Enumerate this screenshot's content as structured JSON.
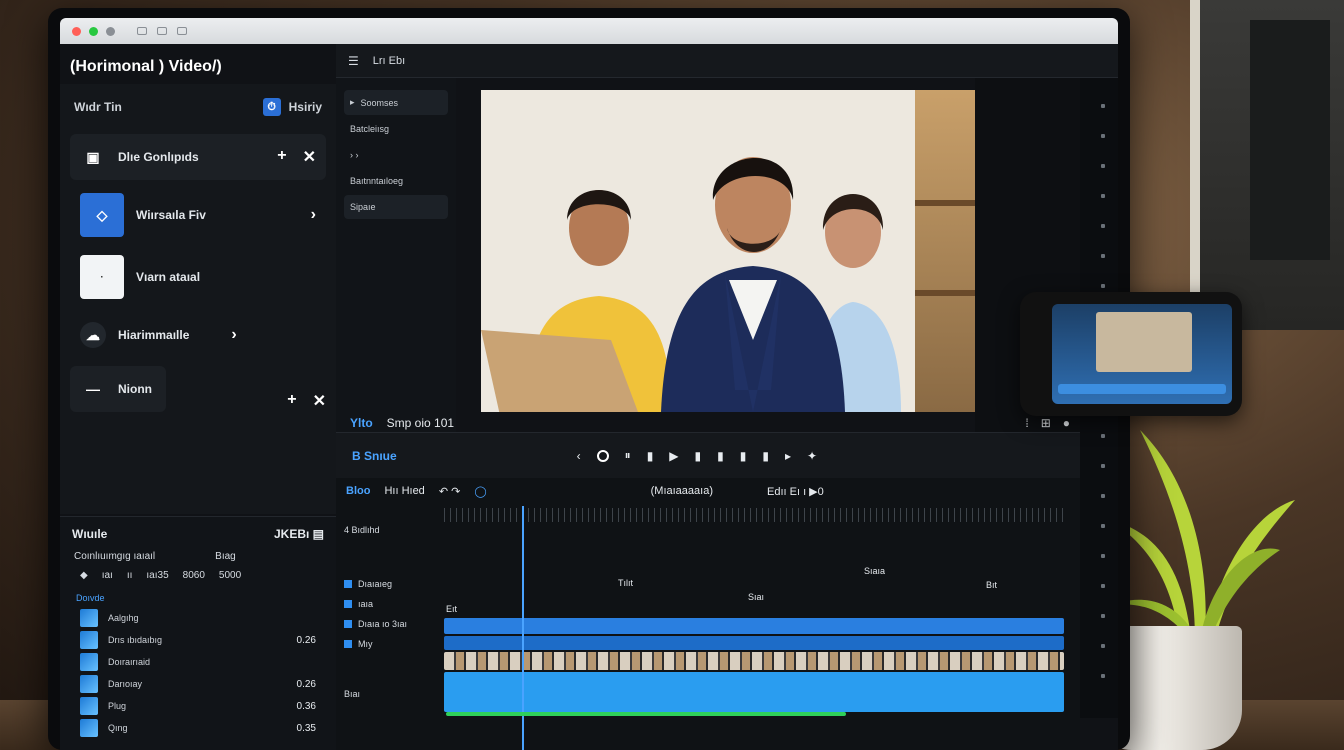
{
  "window": {
    "app_title": "(Horimonal ) Video/)",
    "top_strip": [
      "☰",
      "Lrı Ebı"
    ],
    "titlebar_colors": [
      "#ff5f57",
      "#28c840",
      "#8a8f95"
    ]
  },
  "left_panel": {
    "header": "Wıdr Tin",
    "history_label": "Hsiriy",
    "history_icon": "history-icon",
    "items": [
      {
        "label": "Dlıe Gonlıpıds",
        "icon": "film-icon",
        "actions": [
          "+",
          "✕"
        ]
      },
      {
        "label": "Wiırsaıla   Fiv",
        "icon": "diamond-icon",
        "actions": [
          "›"
        ],
        "accent": "#2b6fd6"
      },
      {
        "label": "Vıarn ataıal",
        "icon": "checkbox-icon",
        "actions": []
      },
      {
        "label": "Hiarimmaılle",
        "icon": "cloud-icon",
        "actions": [
          "›"
        ]
      },
      {
        "label": "Nionn",
        "icon": "minus-icon",
        "actions": [
          "+",
          "✕"
        ]
      }
    ]
  },
  "effects_panel": {
    "items": [
      "Soomses",
      "Batcleiısg",
      "›   ›",
      "Baıtnntaıloeg",
      "Sipaıe"
    ]
  },
  "preview": {
    "status_left": "Ylto",
    "status_text": "Smp oio 101",
    "status_right": [
      "⁞",
      "⊞",
      "●"
    ]
  },
  "controls": {
    "label": "B Snıue",
    "icons": [
      "‹",
      "○",
      "⏸",
      "▮",
      "▶",
      "▮",
      "▮",
      "▮",
      "▮",
      "▸",
      "✦"
    ]
  },
  "media_panel": {
    "header": "Wıuıle",
    "header_right": "JKEBı  ▤",
    "sub_left": "Coınlıuımgıg ıaıaıl",
    "sub_right": "Bıag",
    "tools": [
      "◆",
      "ıaı",
      "ıı",
      "ıaı35",
      "8060",
      "5000"
    ],
    "category": "Doıvde",
    "rows": [
      {
        "label": "Aalgıhg",
        "value": ""
      },
      {
        "label": "Drıs ıbıdaıbıg",
        "value": "0.26"
      },
      {
        "label": "Doıraırıaid",
        "value": ""
      },
      {
        "label": "Darıoıay",
        "value": "0.26"
      },
      {
        "label": "Plug",
        "value": "0.36"
      },
      {
        "label": "Qıng",
        "value": "0.35"
      }
    ]
  },
  "timeline": {
    "label": "Bloo",
    "title": "Hıı Hıed",
    "center_label": "(Mıaıaaaaıa)",
    "right_label": "Edıı  Eı ı  ▶0",
    "track_labels": [
      "4 Bıdlıhd",
      "Dıaıaıeg",
      "ıaıa",
      "Dıaıa  ıo 3ıaı",
      "Mıy",
      "Bıaı"
    ],
    "marks": [
      "Tılıt",
      "Sıaıa",
      "Sıaı",
      "Bıt",
      "Eıt"
    ]
  }
}
